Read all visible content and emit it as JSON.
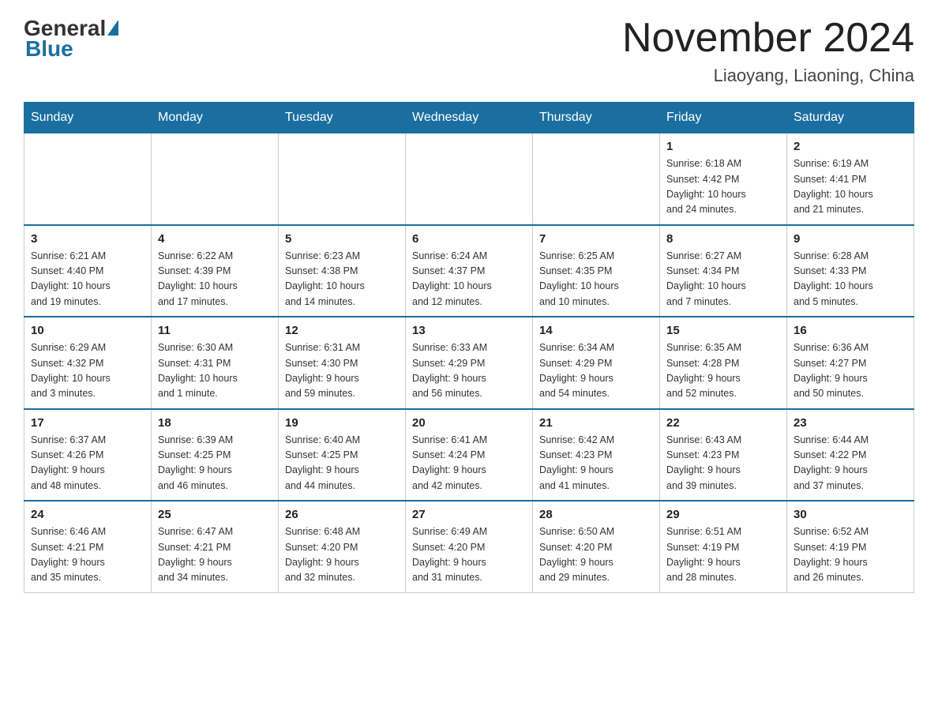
{
  "header": {
    "logo": {
      "general": "General",
      "blue": "Blue"
    },
    "title": "November 2024",
    "subtitle": "Liaoyang, Liaoning, China"
  },
  "weekdays": [
    "Sunday",
    "Monday",
    "Tuesday",
    "Wednesday",
    "Thursday",
    "Friday",
    "Saturday"
  ],
  "weeks": [
    [
      {
        "day": "",
        "info": ""
      },
      {
        "day": "",
        "info": ""
      },
      {
        "day": "",
        "info": ""
      },
      {
        "day": "",
        "info": ""
      },
      {
        "day": "",
        "info": ""
      },
      {
        "day": "1",
        "info": "Sunrise: 6:18 AM\nSunset: 4:42 PM\nDaylight: 10 hours\nand 24 minutes."
      },
      {
        "day": "2",
        "info": "Sunrise: 6:19 AM\nSunset: 4:41 PM\nDaylight: 10 hours\nand 21 minutes."
      }
    ],
    [
      {
        "day": "3",
        "info": "Sunrise: 6:21 AM\nSunset: 4:40 PM\nDaylight: 10 hours\nand 19 minutes."
      },
      {
        "day": "4",
        "info": "Sunrise: 6:22 AM\nSunset: 4:39 PM\nDaylight: 10 hours\nand 17 minutes."
      },
      {
        "day": "5",
        "info": "Sunrise: 6:23 AM\nSunset: 4:38 PM\nDaylight: 10 hours\nand 14 minutes."
      },
      {
        "day": "6",
        "info": "Sunrise: 6:24 AM\nSunset: 4:37 PM\nDaylight: 10 hours\nand 12 minutes."
      },
      {
        "day": "7",
        "info": "Sunrise: 6:25 AM\nSunset: 4:35 PM\nDaylight: 10 hours\nand 10 minutes."
      },
      {
        "day": "8",
        "info": "Sunrise: 6:27 AM\nSunset: 4:34 PM\nDaylight: 10 hours\nand 7 minutes."
      },
      {
        "day": "9",
        "info": "Sunrise: 6:28 AM\nSunset: 4:33 PM\nDaylight: 10 hours\nand 5 minutes."
      }
    ],
    [
      {
        "day": "10",
        "info": "Sunrise: 6:29 AM\nSunset: 4:32 PM\nDaylight: 10 hours\nand 3 minutes."
      },
      {
        "day": "11",
        "info": "Sunrise: 6:30 AM\nSunset: 4:31 PM\nDaylight: 10 hours\nand 1 minute."
      },
      {
        "day": "12",
        "info": "Sunrise: 6:31 AM\nSunset: 4:30 PM\nDaylight: 9 hours\nand 59 minutes."
      },
      {
        "day": "13",
        "info": "Sunrise: 6:33 AM\nSunset: 4:29 PM\nDaylight: 9 hours\nand 56 minutes."
      },
      {
        "day": "14",
        "info": "Sunrise: 6:34 AM\nSunset: 4:29 PM\nDaylight: 9 hours\nand 54 minutes."
      },
      {
        "day": "15",
        "info": "Sunrise: 6:35 AM\nSunset: 4:28 PM\nDaylight: 9 hours\nand 52 minutes."
      },
      {
        "day": "16",
        "info": "Sunrise: 6:36 AM\nSunset: 4:27 PM\nDaylight: 9 hours\nand 50 minutes."
      }
    ],
    [
      {
        "day": "17",
        "info": "Sunrise: 6:37 AM\nSunset: 4:26 PM\nDaylight: 9 hours\nand 48 minutes."
      },
      {
        "day": "18",
        "info": "Sunrise: 6:39 AM\nSunset: 4:25 PM\nDaylight: 9 hours\nand 46 minutes."
      },
      {
        "day": "19",
        "info": "Sunrise: 6:40 AM\nSunset: 4:25 PM\nDaylight: 9 hours\nand 44 minutes."
      },
      {
        "day": "20",
        "info": "Sunrise: 6:41 AM\nSunset: 4:24 PM\nDaylight: 9 hours\nand 42 minutes."
      },
      {
        "day": "21",
        "info": "Sunrise: 6:42 AM\nSunset: 4:23 PM\nDaylight: 9 hours\nand 41 minutes."
      },
      {
        "day": "22",
        "info": "Sunrise: 6:43 AM\nSunset: 4:23 PM\nDaylight: 9 hours\nand 39 minutes."
      },
      {
        "day": "23",
        "info": "Sunrise: 6:44 AM\nSunset: 4:22 PM\nDaylight: 9 hours\nand 37 minutes."
      }
    ],
    [
      {
        "day": "24",
        "info": "Sunrise: 6:46 AM\nSunset: 4:21 PM\nDaylight: 9 hours\nand 35 minutes."
      },
      {
        "day": "25",
        "info": "Sunrise: 6:47 AM\nSunset: 4:21 PM\nDaylight: 9 hours\nand 34 minutes."
      },
      {
        "day": "26",
        "info": "Sunrise: 6:48 AM\nSunset: 4:20 PM\nDaylight: 9 hours\nand 32 minutes."
      },
      {
        "day": "27",
        "info": "Sunrise: 6:49 AM\nSunset: 4:20 PM\nDaylight: 9 hours\nand 31 minutes."
      },
      {
        "day": "28",
        "info": "Sunrise: 6:50 AM\nSunset: 4:20 PM\nDaylight: 9 hours\nand 29 minutes."
      },
      {
        "day": "29",
        "info": "Sunrise: 6:51 AM\nSunset: 4:19 PM\nDaylight: 9 hours\nand 28 minutes."
      },
      {
        "day": "30",
        "info": "Sunrise: 6:52 AM\nSunset: 4:19 PM\nDaylight: 9 hours\nand 26 minutes."
      }
    ]
  ]
}
